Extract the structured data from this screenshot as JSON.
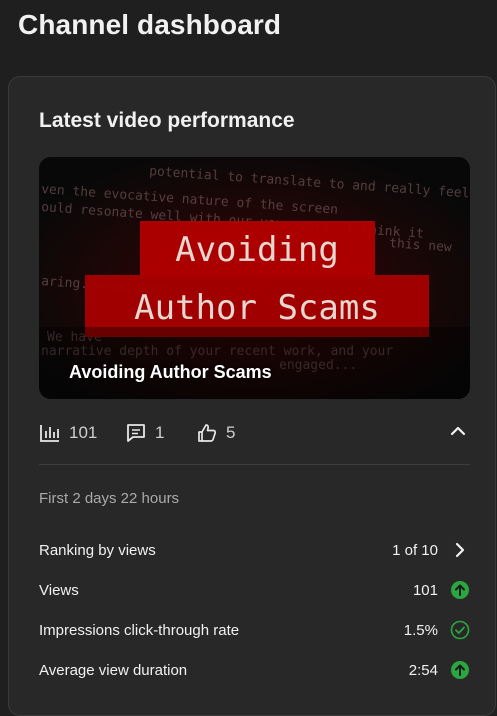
{
  "page": {
    "title": "Channel dashboard"
  },
  "card": {
    "title": "Latest video performance",
    "video": {
      "title": "Avoiding Author Scams",
      "thumbnail_line1": "Avoiding",
      "thumbnail_line2": "Author Scams",
      "thumbnail_bg_text": [
        "potential to translate to and really feel it",
        "ven the evocative nature of the screen",
        "ould resonate well with our your work. I think it",
        "this new",
        "aring. week stoo",
        "We have",
        "narrative depth of your recent work, and your",
        "engaged..."
      ]
    },
    "stats": {
      "views": "101",
      "comments": "1",
      "likes": "5"
    },
    "period": "First 2 days 22 hours",
    "metrics": [
      {
        "label": "Ranking by views",
        "value": "1 of 10",
        "indicator": "chevron-right-icon"
      },
      {
        "label": "Views",
        "value": "101",
        "indicator": "arrow-up-circle-icon"
      },
      {
        "label": "Impressions click-through rate",
        "value": "1.5%",
        "indicator": "check-circle-icon"
      },
      {
        "label": "Average view duration",
        "value": "2:54",
        "indicator": "arrow-up-circle-icon"
      }
    ]
  },
  "colors": {
    "background": "#1f1f1f",
    "card": "#282828",
    "positive_green": "#2ba640",
    "thumbnail_red": "#b30000"
  }
}
